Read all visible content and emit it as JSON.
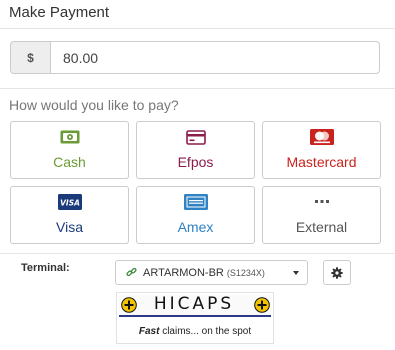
{
  "title": "Make Payment",
  "amount": {
    "currency_symbol": "$",
    "value": "80.00"
  },
  "question": "How would you like to pay?",
  "methods": [
    {
      "label": "Cash",
      "icon": "cash-icon",
      "color": "#6b9b34"
    },
    {
      "label": "Efpos",
      "icon": "credit-card-icon",
      "color": "#8b1c4b"
    },
    {
      "label": "Mastercard",
      "icon": "mastercard-icon",
      "color": "#c9231d"
    },
    {
      "label": "Visa",
      "icon": "visa-icon",
      "color": "#1a3a7a"
    },
    {
      "label": "Amex",
      "icon": "amex-icon",
      "color": "#2f82c3"
    },
    {
      "label": "External",
      "icon": "ellipsis-icon",
      "color": "#555555"
    }
  ],
  "terminal": {
    "label": "Terminal:",
    "name": "ARTARMON-BR",
    "code": "(S1234X)"
  },
  "hicaps": {
    "wordmark": "HICAPS",
    "tagline_bold": "Fast",
    "tagline_rest": "claims... on the spot"
  },
  "badges": {
    "visa": "VISA"
  },
  "colors": {
    "border": "#cccccc",
    "hicaps_navy": "#2e3a87",
    "hicaps_yellow": "#f2c500"
  }
}
